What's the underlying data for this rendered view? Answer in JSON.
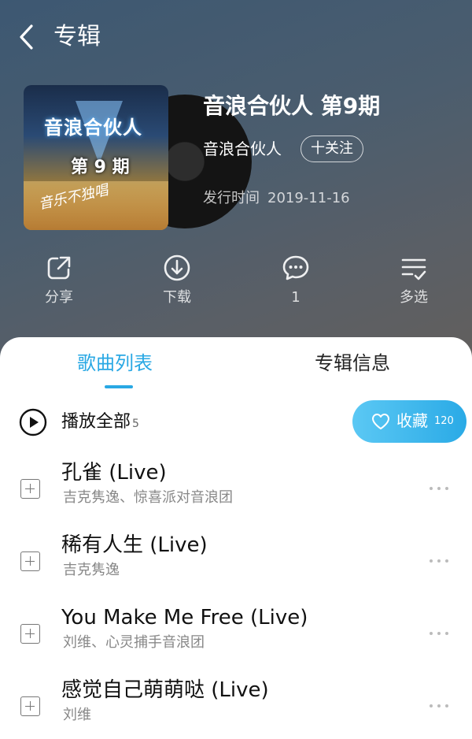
{
  "header": {
    "page_title": "专辑",
    "album_title": "音浪合伙人 第9期",
    "artist": "音浪合伙人",
    "follow_label": "十关注",
    "release_label": "发行时间",
    "release_date": "2019-11-16"
  },
  "cover": {
    "title_text": "音浪合伙人",
    "episode_text": "第 9 期",
    "scribble_text": "音乐不独唱"
  },
  "actions": [
    {
      "label": "分享",
      "icon": "share-icon"
    },
    {
      "label": "下载",
      "icon": "download-icon"
    },
    {
      "label": "1",
      "icon": "comment-icon"
    },
    {
      "label": "多选",
      "icon": "multi-select-icon"
    }
  ],
  "tabs": {
    "active": "歌曲列表",
    "inactive": "专辑信息"
  },
  "playlist": {
    "play_all_label": "播放全部",
    "count": "5",
    "collect_label": "收藏",
    "collect_count": "120"
  },
  "songs": [
    {
      "title": "孔雀 (Live)",
      "artist": "吉克隽逸、惊喜派对音浪团"
    },
    {
      "title": "稀有人生 (Live)",
      "artist": "吉克隽逸"
    },
    {
      "title": "You Make Me Free (Live)",
      "artist": "刘维、心灵捕手音浪团"
    },
    {
      "title": "感觉自己萌萌哒 (Live)",
      "artist": "刘维"
    }
  ],
  "colors": {
    "accent": "#29a8e4",
    "header_top": "#3d5872",
    "header_bottom": "#625f5d"
  }
}
